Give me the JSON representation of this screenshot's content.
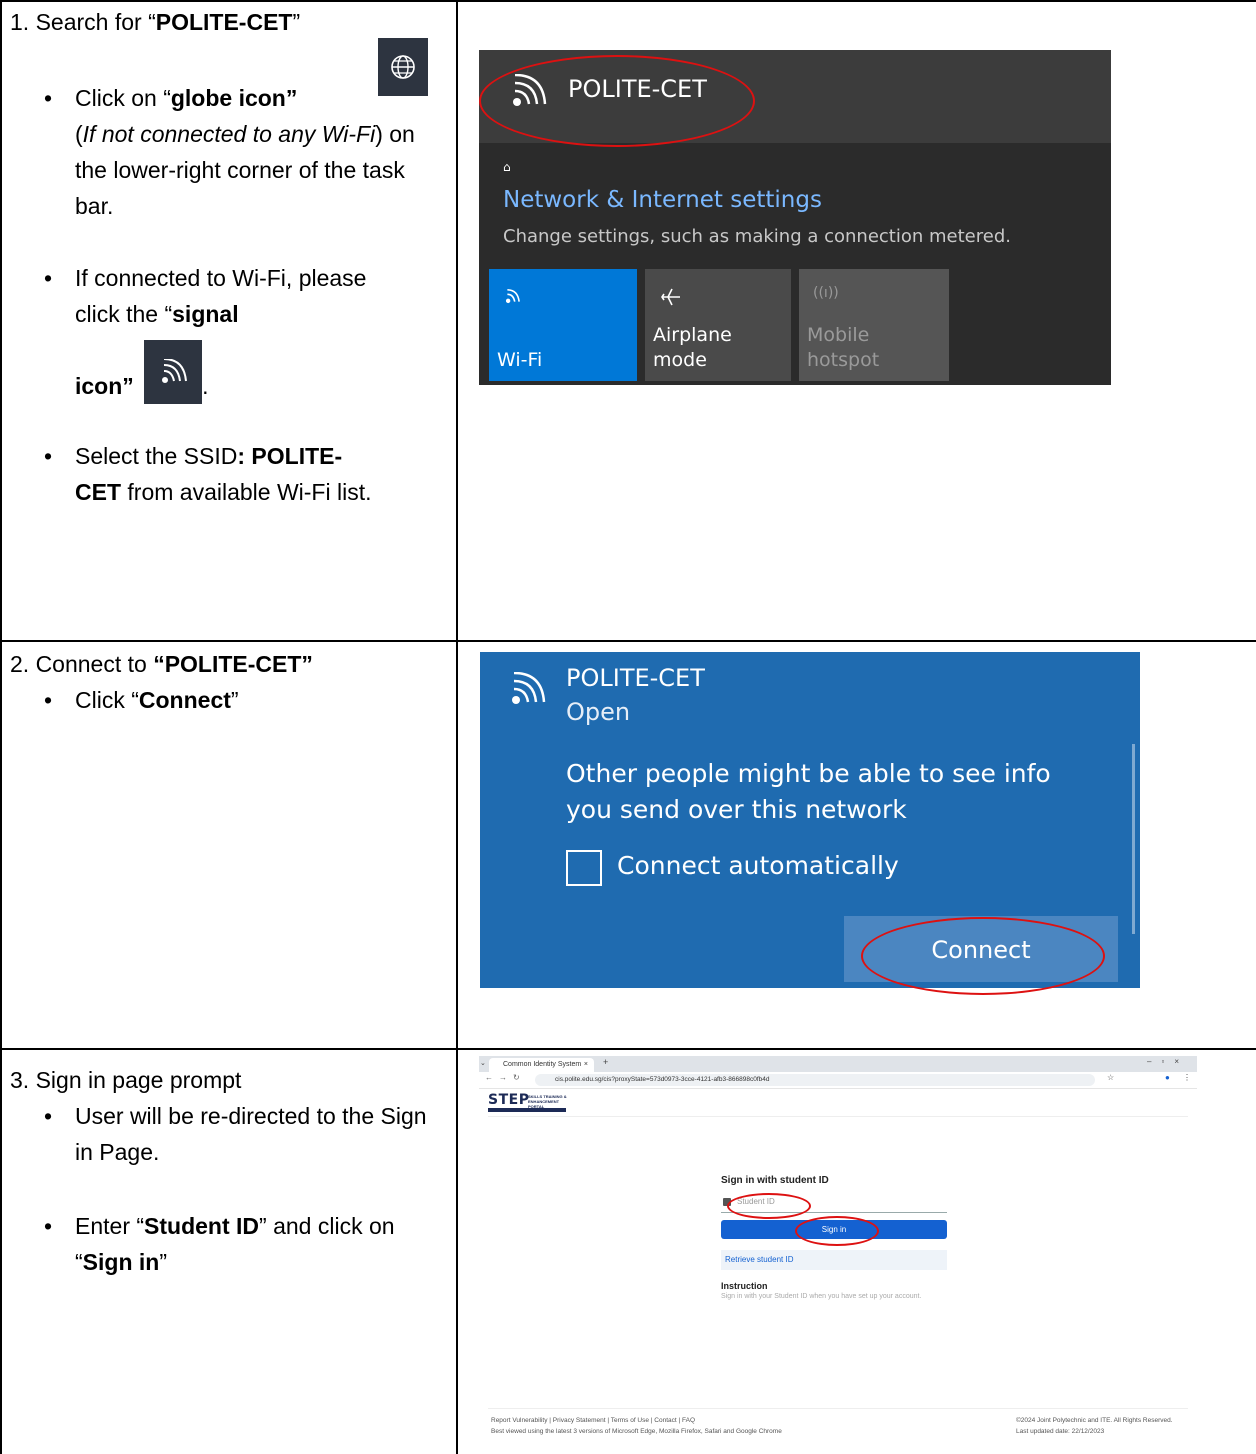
{
  "step1": {
    "prefix": "1. Search for “",
    "ssid": "POLITE-CET",
    "suffix": "”",
    "b1_pre": "Click on “",
    "b1_bold": "globe icon”",
    "b1_ital_open": "(",
    "b1_ital": "If not connected to any Wi-Fi",
    "b1_rest": ") on the lower-right corner of the task bar.",
    "b2_pre": "If connected to Wi-Fi, please click the “",
    "b2_bold": "signal",
    "b2_bold2": "icon”",
    "b2_end": ".",
    "b3_pre": "Select the SSID",
    "b3_bold": ": POLITE-CET",
    "b3_rest": " from available Wi-Fi list."
  },
  "step2": {
    "prefix": "2. Connect to ",
    "ssid": "“POLITE-CET”",
    "b1_pre": "Click “",
    "b1_bold": "Connect",
    "b1_end": "”"
  },
  "step3": {
    "title": "3. Sign in page prompt",
    "b1": "User will be re-directed to the Sign in Page.",
    "b2_pre": "Enter “",
    "b2_bold": "Student ID",
    "b2_mid": "” and click on “",
    "b2_bold2": "Sign in",
    "b2_end": "”"
  },
  "shot1": {
    "ssid": "POLITE-CET",
    "lock_glyph": "⌂",
    "settings_title": "Network & Internet settings",
    "settings_sub": "Change settings, such as making a connection metered.",
    "tiles": [
      "Wi-Fi",
      "Airplane mode",
      "Mobile hotspot"
    ],
    "tile_colors": [
      "#0078d7",
      "#4a4a4a",
      "#555555"
    ]
  },
  "shot2": {
    "ssid": "POLITE-CET",
    "status": "Open",
    "warning": "Other people might be able to see info you send over this network",
    "auto_label": "Connect automatically",
    "connect_label": "Connect"
  },
  "shot3": {
    "tab_title": "Common Identity System",
    "url": "cis.polite.edu.sg/cis?proxyState=573d0973-3cce-4121-afb3-866898c0fb4d",
    "logo": "STEP",
    "logo_sub": "SKILLS TRAINING & ENHANCEMENT PORTAL",
    "signin_title": "Sign in with student ID",
    "student_id_placeholder": "Student ID",
    "signin_button": "Sign in",
    "retrieve": "Retrieve student ID",
    "instruction_title": "Instruction",
    "instruction_text": "Sign in with your Student ID when you have set up your account.",
    "footer_links": "Report Vulnerability | Privacy Statement | Terms of Use | Contact | FAQ",
    "footer_browsers": "Best viewed using the latest 3 versions of Microsoft Edge, Mozilla Firefox, Safari and Google Chrome",
    "footer_copy": "©2024 Joint Polytechnic and ITE. All Rights Reserved.",
    "footer_updated": "Last updated date: 22/12/2023"
  }
}
